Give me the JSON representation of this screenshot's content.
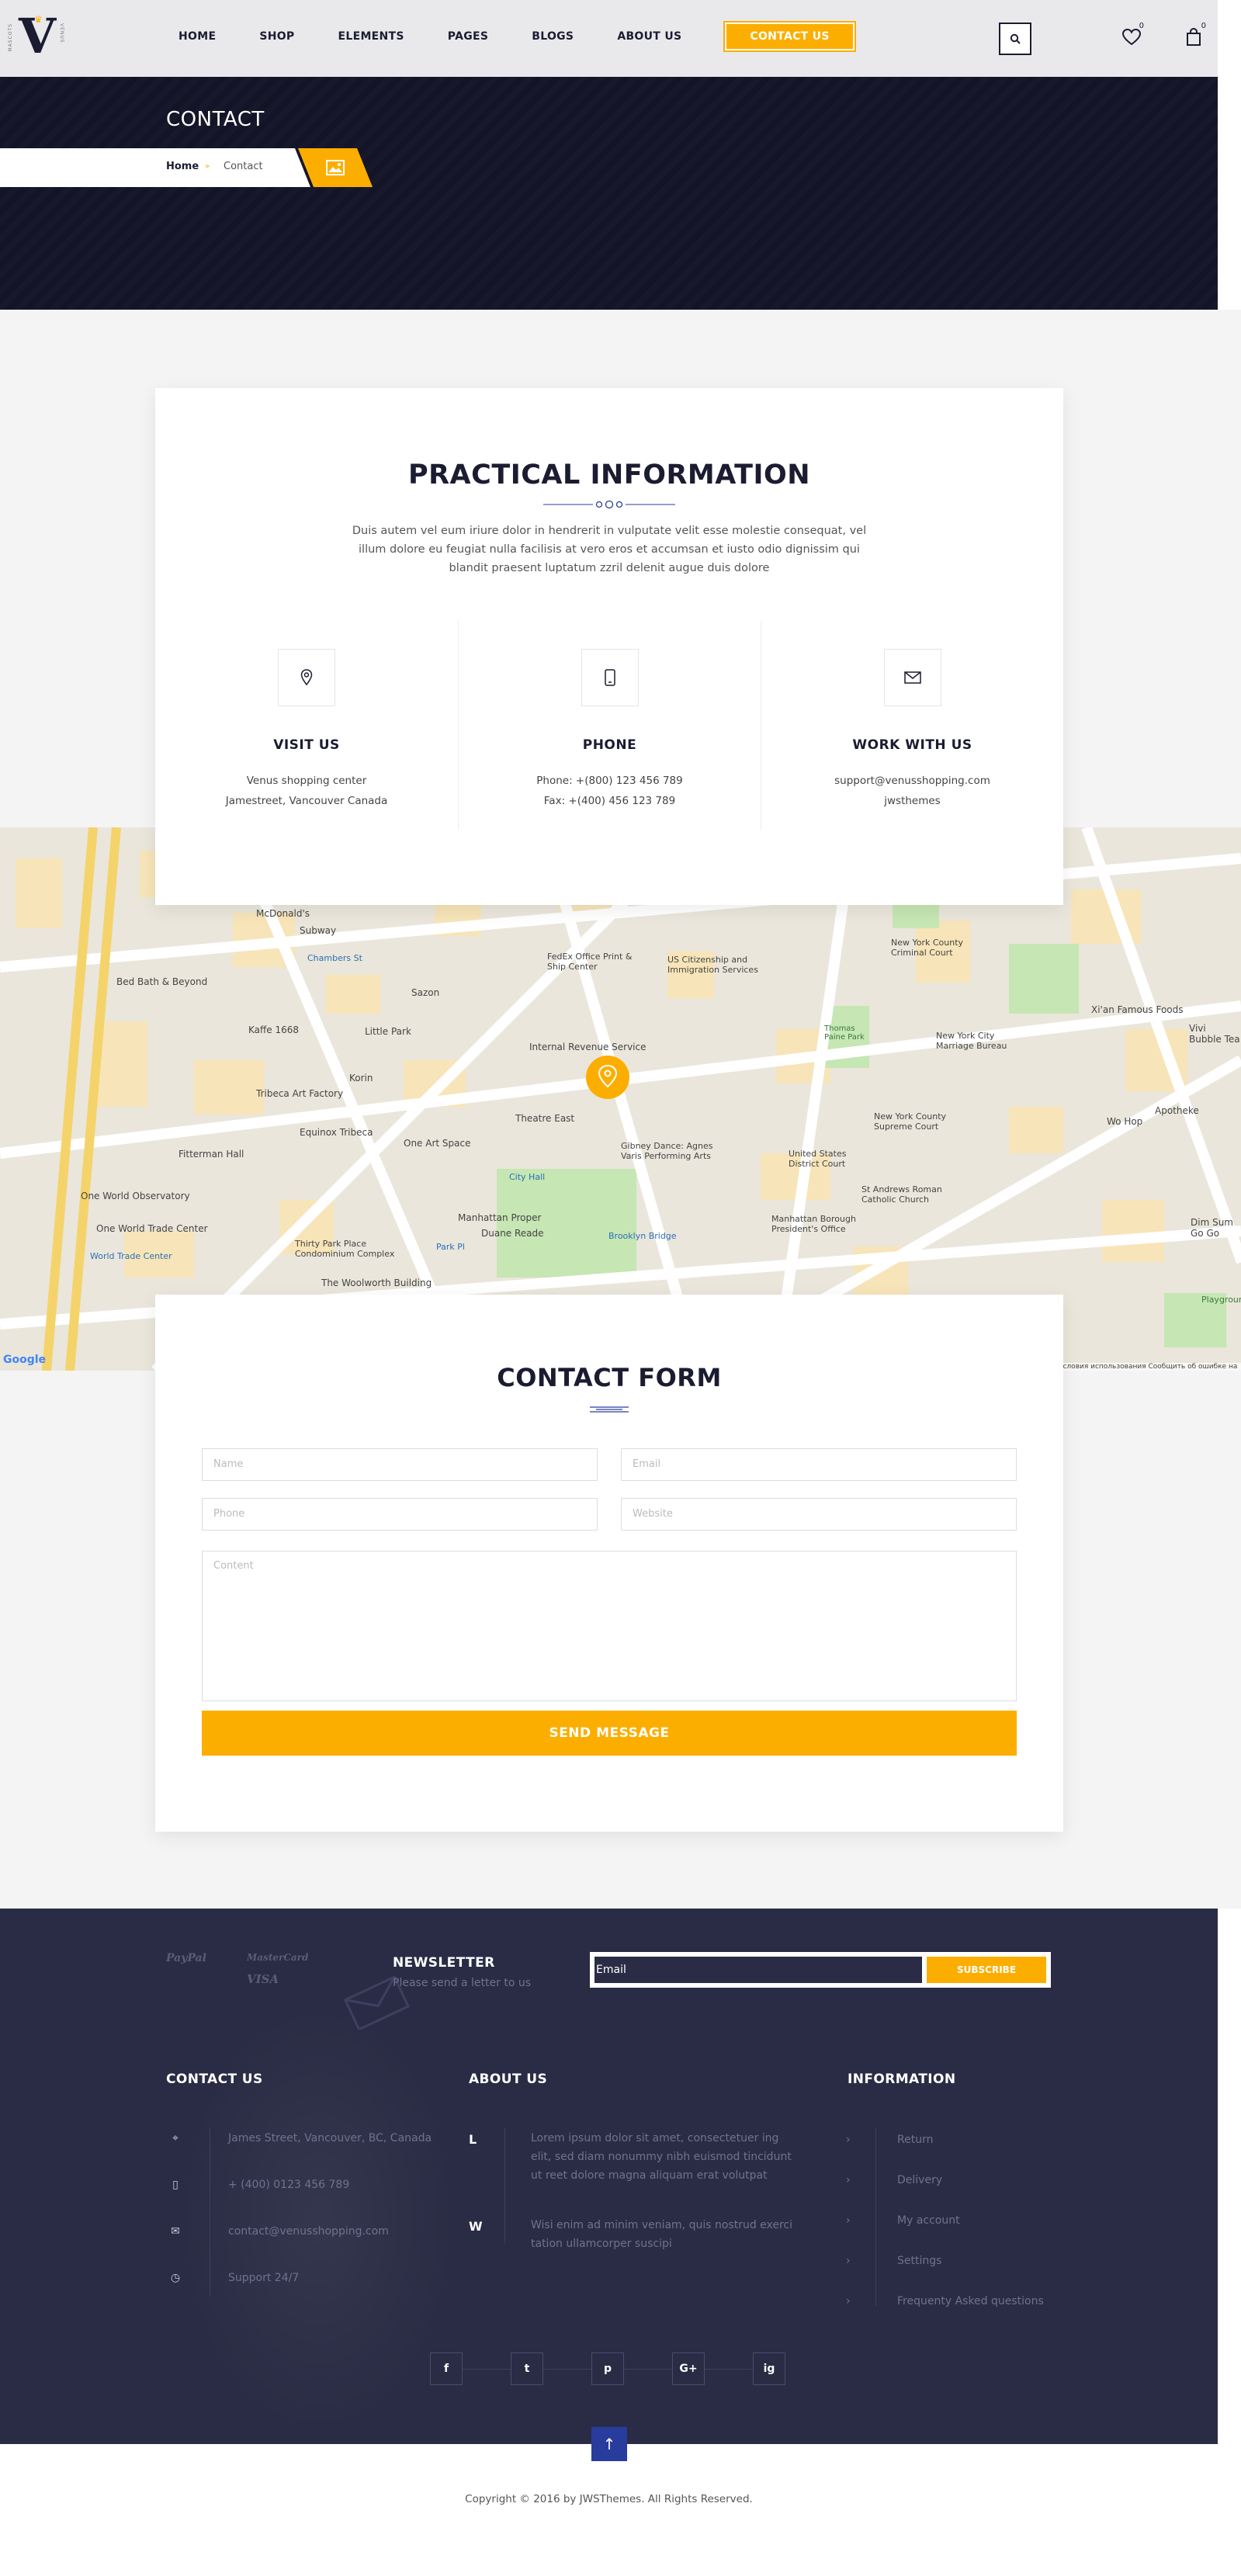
{
  "brand": {
    "logo_letter": "V",
    "side_left": "MASCOTS",
    "side_right": "VENUS"
  },
  "nav": {
    "items": [
      "HOME",
      "SHOP",
      "ELEMENTS",
      "PAGES",
      "BLOGS",
      "ABOUT US"
    ],
    "cta": "CONTACT US",
    "wishlist_count": "0",
    "cart_count": "0"
  },
  "titlebar": {
    "title": "CONTACT",
    "crumb_home": "Home",
    "crumb_sep": "»",
    "crumb_current": "Contact"
  },
  "info": {
    "title": "PRACTICAL INFORMATION",
    "intro": "Duis autem vel eum iriure dolor in hendrerit in vulputate velit esse molestie consequat, vel illum dolore eu feugiat nulla facilisis at vero eros et accumsan et iusto odio dignissim qui blandit praesent luptatum zzril delenit augue duis dolore",
    "visit": {
      "title": "VISIT US",
      "line1": "Venus shopping center",
      "line2": "Jamestreet, Vancouver Canada"
    },
    "phone": {
      "title": "PHONE",
      "line1": "Phone: +(800) 123 456 789",
      "line2": "Fax: +(400) 456 123 789"
    },
    "work": {
      "title": "WORK WITH US",
      "line1": "support@venusshopping.com",
      "line2": "jwsthemes"
    }
  },
  "map": {
    "labels": [
      "McDonald's",
      "Bed Bath & Beyond",
      "Kaffe 1668",
      "Little Park",
      "FedEx Office Print & Ship Center",
      "US Citizenship and Immigration Services",
      "Internal Revenue Service",
      "New York County Criminal Court",
      "New York City Marriage Bureau",
      "Thomas Paine Park",
      "Tribeca Art Factory",
      "Equinox Tribeca",
      "One Art Space",
      "Theatre East",
      "Gibney Dance: Agnes Varis Performing Arts",
      "New York County Supreme Court",
      "United States District Court",
      "St Andrews Roman Catholic Church",
      "Manhattan Borough President's Office",
      "One World Observatory",
      "One World Trade Center",
      "Thirty Park Place Condominium Complex",
      "Manhattan Proper",
      "Duane Reade",
      "The Woolworth Building",
      "World Trade Center",
      "Xi'an Famous Foods",
      "Vivi Bubble Tea",
      "Wo Hop",
      "Apotheke",
      "Dim Sum Go Go",
      "Chambers St",
      "Fitterman Hall",
      "Korin",
      "City Hall",
      "Brooklyn Bridge",
      "Park Pl",
      "Sazon",
      "Subway",
      "Playground"
    ],
    "footer_left": "Google",
    "footer_right": "Условия использования   Сообщить об ошибке на карте"
  },
  "form": {
    "title": "CONTACT FORM",
    "name_placeholder": "Name",
    "email_placeholder": "Email",
    "phone_placeholder": "Phone",
    "website_placeholder": "Website",
    "content_placeholder": "Content",
    "submit": "SEND MESSAGE"
  },
  "footer": {
    "payments": [
      "PayPal",
      "MasterCard",
      "VISA"
    ],
    "newsletter_title": "NEWSLETTER",
    "newsletter_sub": "Please send a letter to us",
    "newsletter_placeholder": "Email",
    "newsletter_button": "SUBSCRIBE",
    "contact_title": "CONTACT US",
    "contact_rows": [
      "James Street, Vancouver, BC, Canada",
      "+ (400) 0123 456 789",
      "contact@venusshopping.com",
      "Support 24/7"
    ],
    "about_title": "ABOUT US",
    "about_l_letter": "L",
    "about_l_text": "Lorem ipsum dolor sit amet, consectetuer ing elit, sed diam nonummy nibh euismod tincidunt ut reet dolore magna aliquam erat volutpat",
    "about_w_letter": "W",
    "about_w_text": "Wisi enim ad minim veniam, quis nostrud exerci tation ullamcorper suscipi",
    "info_title": "INFORMATION",
    "info_links": [
      "Return",
      "Delivery",
      "My account",
      "Settings",
      "Frequenty Asked questions"
    ],
    "social": [
      "f",
      "t",
      "p",
      "G+",
      "ig"
    ]
  },
  "copyright": "Copyright © 2016 by JWSThemes. All Rights Reserved.",
  "colors": {
    "accent": "#fcae00",
    "dark": "#141428",
    "footer": "#2a2c45",
    "top_button": "#283c9e"
  }
}
